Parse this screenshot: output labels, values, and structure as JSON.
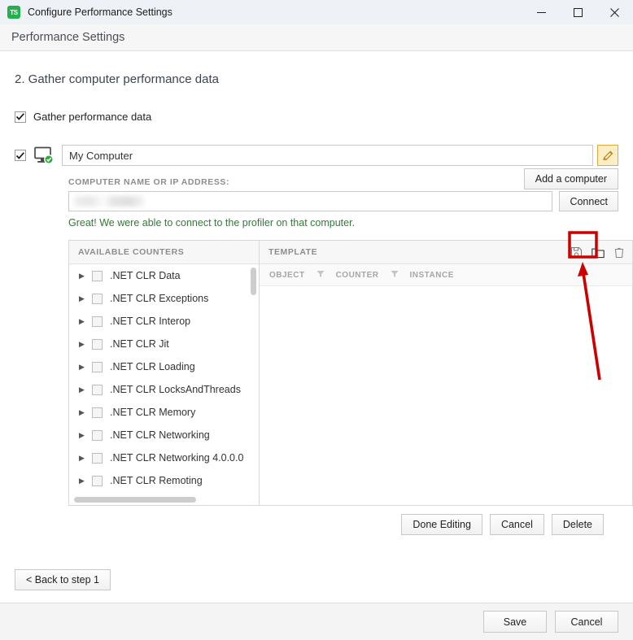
{
  "window": {
    "title": "Configure Performance Settings",
    "app_icon": "ts-logo-icon",
    "minimize": "minimize-icon",
    "maximize": "maximize-icon",
    "close": "close-icon"
  },
  "subheader": {
    "title": "Performance Settings"
  },
  "main": {
    "step_title": "2. Gather computer performance data",
    "gather_checkbox": {
      "label": "Gather performance data",
      "checked": true
    },
    "add_computer_button": "Add a computer"
  },
  "computer": {
    "enabled": true,
    "icon": "monitor-connected-icon",
    "name": "My Computer",
    "name_placeholder": "Computer name",
    "edit_button_icon": "pencil-icon",
    "field_label": "COMPUTER NAME OR IP ADDRESS:",
    "address_value": "",
    "address_redacted": true,
    "connect_button": "Connect",
    "status_message": "Great! We were able to connect to the profiler on that computer.",
    "status_color": "#2e7d32"
  },
  "counters_panel": {
    "available_header": "AVAILABLE COUNTERS",
    "template_header": "TEMPLATE",
    "template_icons": [
      {
        "name": "save-template-icon",
        "glyph": "save"
      },
      {
        "name": "open-template-folder-icon",
        "glyph": "folder",
        "highlighted": true
      },
      {
        "name": "delete-template-icon",
        "glyph": "trash"
      }
    ],
    "grid_columns": [
      {
        "label": "OBJECT",
        "filter": true
      },
      {
        "label": "COUNTER",
        "filter": true
      },
      {
        "label": "INSTANCE",
        "filter": false
      }
    ],
    "counters": [
      ".NET CLR Data",
      ".NET CLR Exceptions",
      ".NET CLR Interop",
      ".NET CLR Jit",
      ".NET CLR Loading",
      ".NET CLR LocksAndThreads",
      ".NET CLR Memory",
      ".NET CLR Networking",
      ".NET CLR Networking 4.0.0.0",
      ".NET CLR Remoting"
    ],
    "template_rows": []
  },
  "panel_actions": {
    "done_editing": "Done Editing",
    "cancel": "Cancel",
    "delete": "Delete"
  },
  "navigation": {
    "back_button": "< Back to step 1"
  },
  "footer": {
    "save": "Save",
    "cancel": "Cancel"
  },
  "annotation": {
    "highlight_color": "#cc0000",
    "arrow_color": "#cc0000",
    "target": "open-template-folder-icon"
  }
}
